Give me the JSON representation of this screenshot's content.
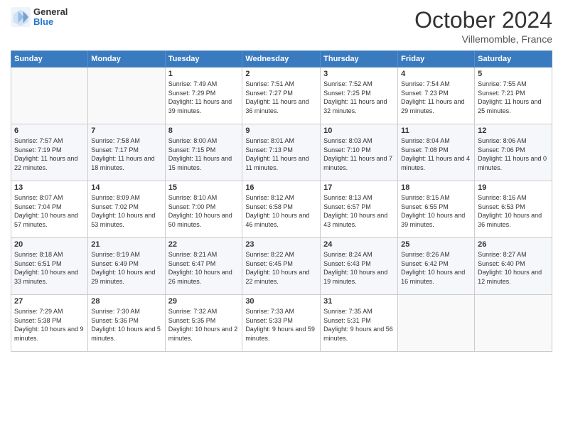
{
  "header": {
    "logo_general": "General",
    "logo_blue": "Blue",
    "month": "October 2024",
    "location": "Villemomble, France"
  },
  "weekdays": [
    "Sunday",
    "Monday",
    "Tuesday",
    "Wednesday",
    "Thursday",
    "Friday",
    "Saturday"
  ],
  "weeks": [
    [
      {
        "day": "",
        "info": ""
      },
      {
        "day": "",
        "info": ""
      },
      {
        "day": "1",
        "info": "Sunrise: 7:49 AM\nSunset: 7:29 PM\nDaylight: 11 hours and 39 minutes."
      },
      {
        "day": "2",
        "info": "Sunrise: 7:51 AM\nSunset: 7:27 PM\nDaylight: 11 hours and 36 minutes."
      },
      {
        "day": "3",
        "info": "Sunrise: 7:52 AM\nSunset: 7:25 PM\nDaylight: 11 hours and 32 minutes."
      },
      {
        "day": "4",
        "info": "Sunrise: 7:54 AM\nSunset: 7:23 PM\nDaylight: 11 hours and 29 minutes."
      },
      {
        "day": "5",
        "info": "Sunrise: 7:55 AM\nSunset: 7:21 PM\nDaylight: 11 hours and 25 minutes."
      }
    ],
    [
      {
        "day": "6",
        "info": "Sunrise: 7:57 AM\nSunset: 7:19 PM\nDaylight: 11 hours and 22 minutes."
      },
      {
        "day": "7",
        "info": "Sunrise: 7:58 AM\nSunset: 7:17 PM\nDaylight: 11 hours and 18 minutes."
      },
      {
        "day": "8",
        "info": "Sunrise: 8:00 AM\nSunset: 7:15 PM\nDaylight: 11 hours and 15 minutes."
      },
      {
        "day": "9",
        "info": "Sunrise: 8:01 AM\nSunset: 7:13 PM\nDaylight: 11 hours and 11 minutes."
      },
      {
        "day": "10",
        "info": "Sunrise: 8:03 AM\nSunset: 7:10 PM\nDaylight: 11 hours and 7 minutes."
      },
      {
        "day": "11",
        "info": "Sunrise: 8:04 AM\nSunset: 7:08 PM\nDaylight: 11 hours and 4 minutes."
      },
      {
        "day": "12",
        "info": "Sunrise: 8:06 AM\nSunset: 7:06 PM\nDaylight: 11 hours and 0 minutes."
      }
    ],
    [
      {
        "day": "13",
        "info": "Sunrise: 8:07 AM\nSunset: 7:04 PM\nDaylight: 10 hours and 57 minutes."
      },
      {
        "day": "14",
        "info": "Sunrise: 8:09 AM\nSunset: 7:02 PM\nDaylight: 10 hours and 53 minutes."
      },
      {
        "day": "15",
        "info": "Sunrise: 8:10 AM\nSunset: 7:00 PM\nDaylight: 10 hours and 50 minutes."
      },
      {
        "day": "16",
        "info": "Sunrise: 8:12 AM\nSunset: 6:58 PM\nDaylight: 10 hours and 46 minutes."
      },
      {
        "day": "17",
        "info": "Sunrise: 8:13 AM\nSunset: 6:57 PM\nDaylight: 10 hours and 43 minutes."
      },
      {
        "day": "18",
        "info": "Sunrise: 8:15 AM\nSunset: 6:55 PM\nDaylight: 10 hours and 39 minutes."
      },
      {
        "day": "19",
        "info": "Sunrise: 8:16 AM\nSunset: 6:53 PM\nDaylight: 10 hours and 36 minutes."
      }
    ],
    [
      {
        "day": "20",
        "info": "Sunrise: 8:18 AM\nSunset: 6:51 PM\nDaylight: 10 hours and 33 minutes."
      },
      {
        "day": "21",
        "info": "Sunrise: 8:19 AM\nSunset: 6:49 PM\nDaylight: 10 hours and 29 minutes."
      },
      {
        "day": "22",
        "info": "Sunrise: 8:21 AM\nSunset: 6:47 PM\nDaylight: 10 hours and 26 minutes."
      },
      {
        "day": "23",
        "info": "Sunrise: 8:22 AM\nSunset: 6:45 PM\nDaylight: 10 hours and 22 minutes."
      },
      {
        "day": "24",
        "info": "Sunrise: 8:24 AM\nSunset: 6:43 PM\nDaylight: 10 hours and 19 minutes."
      },
      {
        "day": "25",
        "info": "Sunrise: 8:26 AM\nSunset: 6:42 PM\nDaylight: 10 hours and 16 minutes."
      },
      {
        "day": "26",
        "info": "Sunrise: 8:27 AM\nSunset: 6:40 PM\nDaylight: 10 hours and 12 minutes."
      }
    ],
    [
      {
        "day": "27",
        "info": "Sunrise: 7:29 AM\nSunset: 5:38 PM\nDaylight: 10 hours and 9 minutes."
      },
      {
        "day": "28",
        "info": "Sunrise: 7:30 AM\nSunset: 5:36 PM\nDaylight: 10 hours and 5 minutes."
      },
      {
        "day": "29",
        "info": "Sunrise: 7:32 AM\nSunset: 5:35 PM\nDaylight: 10 hours and 2 minutes."
      },
      {
        "day": "30",
        "info": "Sunrise: 7:33 AM\nSunset: 5:33 PM\nDaylight: 9 hours and 59 minutes."
      },
      {
        "day": "31",
        "info": "Sunrise: 7:35 AM\nSunset: 5:31 PM\nDaylight: 9 hours and 56 minutes."
      },
      {
        "day": "",
        "info": ""
      },
      {
        "day": "",
        "info": ""
      }
    ]
  ]
}
